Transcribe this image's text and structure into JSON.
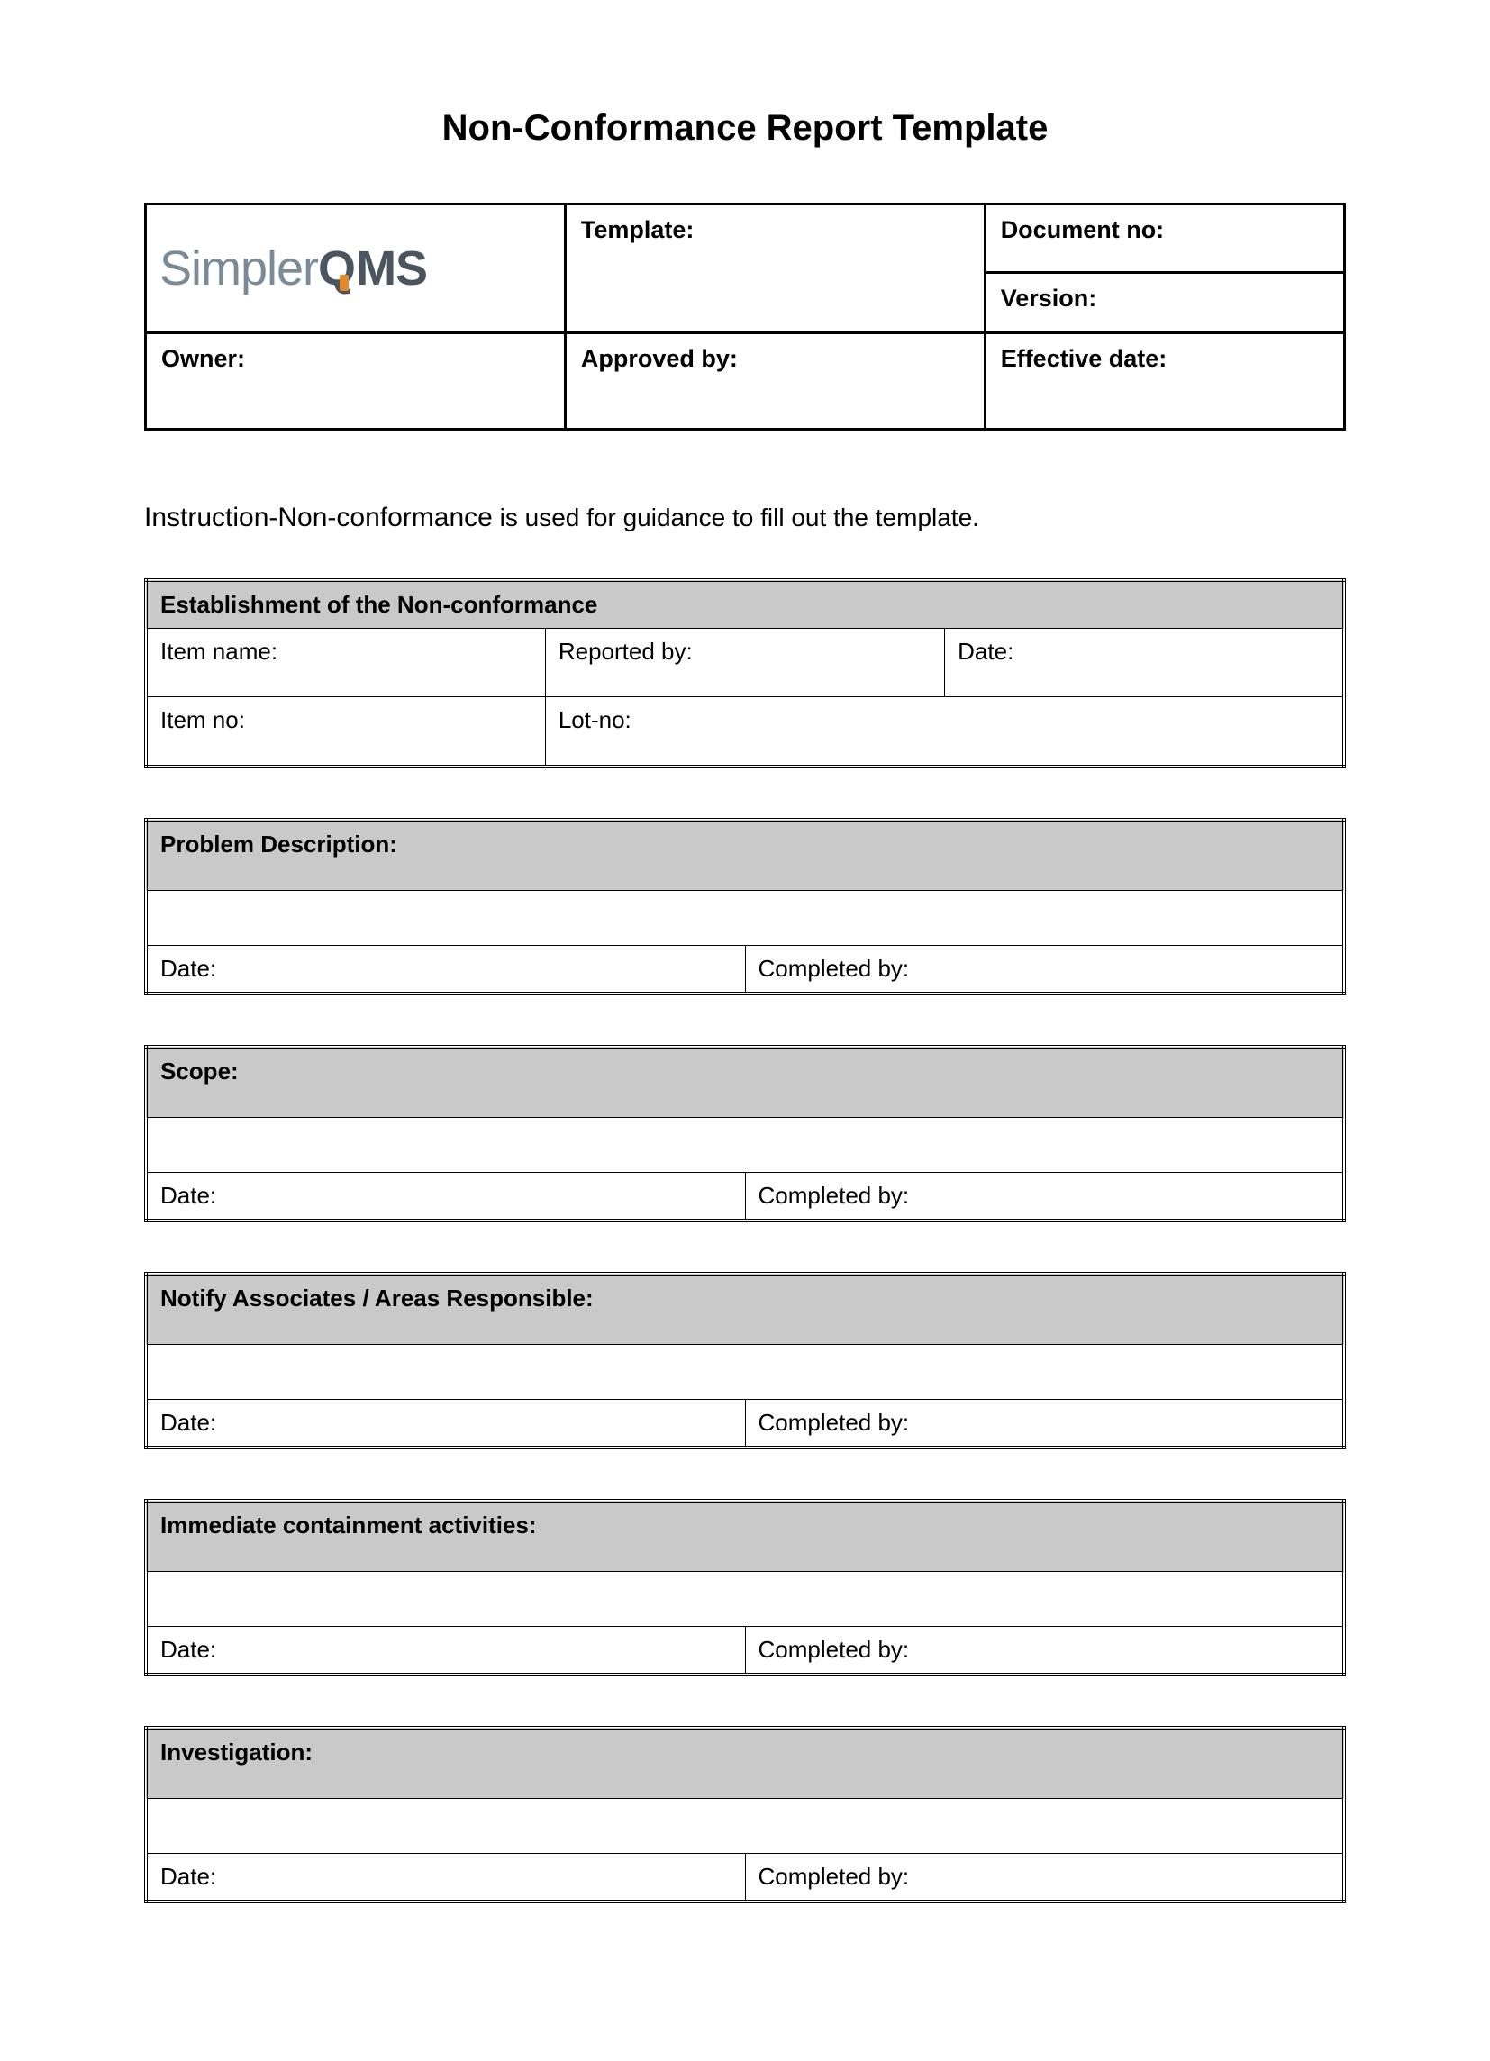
{
  "title": "Non-Conformance Report Template",
  "logo": {
    "part1": "Simpler",
    "part2_q": "Q",
    "part3_ms": "MS"
  },
  "header": {
    "template_label": "Template:",
    "document_no_label": "Document no:",
    "version_label": "Version:",
    "owner_label": "Owner:",
    "approved_by_label": "Approved by:",
    "effective_date_label": "Effective date:"
  },
  "instruction": {
    "lead": "Instruction-Non-conformance",
    "rest": " is used for guidance to fill out the template."
  },
  "sections": {
    "establishment": {
      "title": "Establishment of the Non-conformance",
      "item_name": "Item name:",
      "reported_by": "Reported by:",
      "date": "Date:",
      "item_no": "Item no:",
      "lot_no": "Lot-no:"
    },
    "problem_description": {
      "title": "Problem Description:",
      "date": "Date:",
      "completed_by": "Completed by:"
    },
    "scope": {
      "title": "Scope:",
      "date": "Date:",
      "completed_by": "Completed by:"
    },
    "notify": {
      "title": "Notify Associates / Areas Responsible:",
      "date": "Date:",
      "completed_by": "Completed by:"
    },
    "containment": {
      "title": "Immediate containment activities:",
      "date": "Date:",
      "completed_by": "Completed by:"
    },
    "investigation": {
      "title": "Investigation:",
      "date": "Date:",
      "completed_by": "Completed by:"
    }
  }
}
